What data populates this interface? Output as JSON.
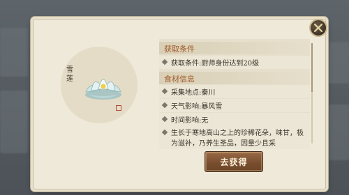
{
  "item": {
    "name": "雪莲"
  },
  "sections": {
    "acquire": {
      "title": "获取条件",
      "rows": [
        "获取条件:厨师身份达到20级"
      ]
    },
    "info": {
      "title": "食材信息",
      "rows": [
        "采集地点:秦川",
        "天气影响:暴风雪",
        "时间影响:无"
      ]
    },
    "description": "生长于寒地高山之上的珍稀花朵，味甘，极为滋补，乃养生圣品，因量少且采"
  },
  "buttons": {
    "go": "去获得"
  },
  "icons": {
    "close": "close-x-icon",
    "bullet": "diamond-bullet-icon",
    "item": "snow-lotus-icon"
  },
  "colors": {
    "section_title": "#a05a2a",
    "button": "#7a4f30",
    "dialog_bg": "#efe9d9"
  }
}
